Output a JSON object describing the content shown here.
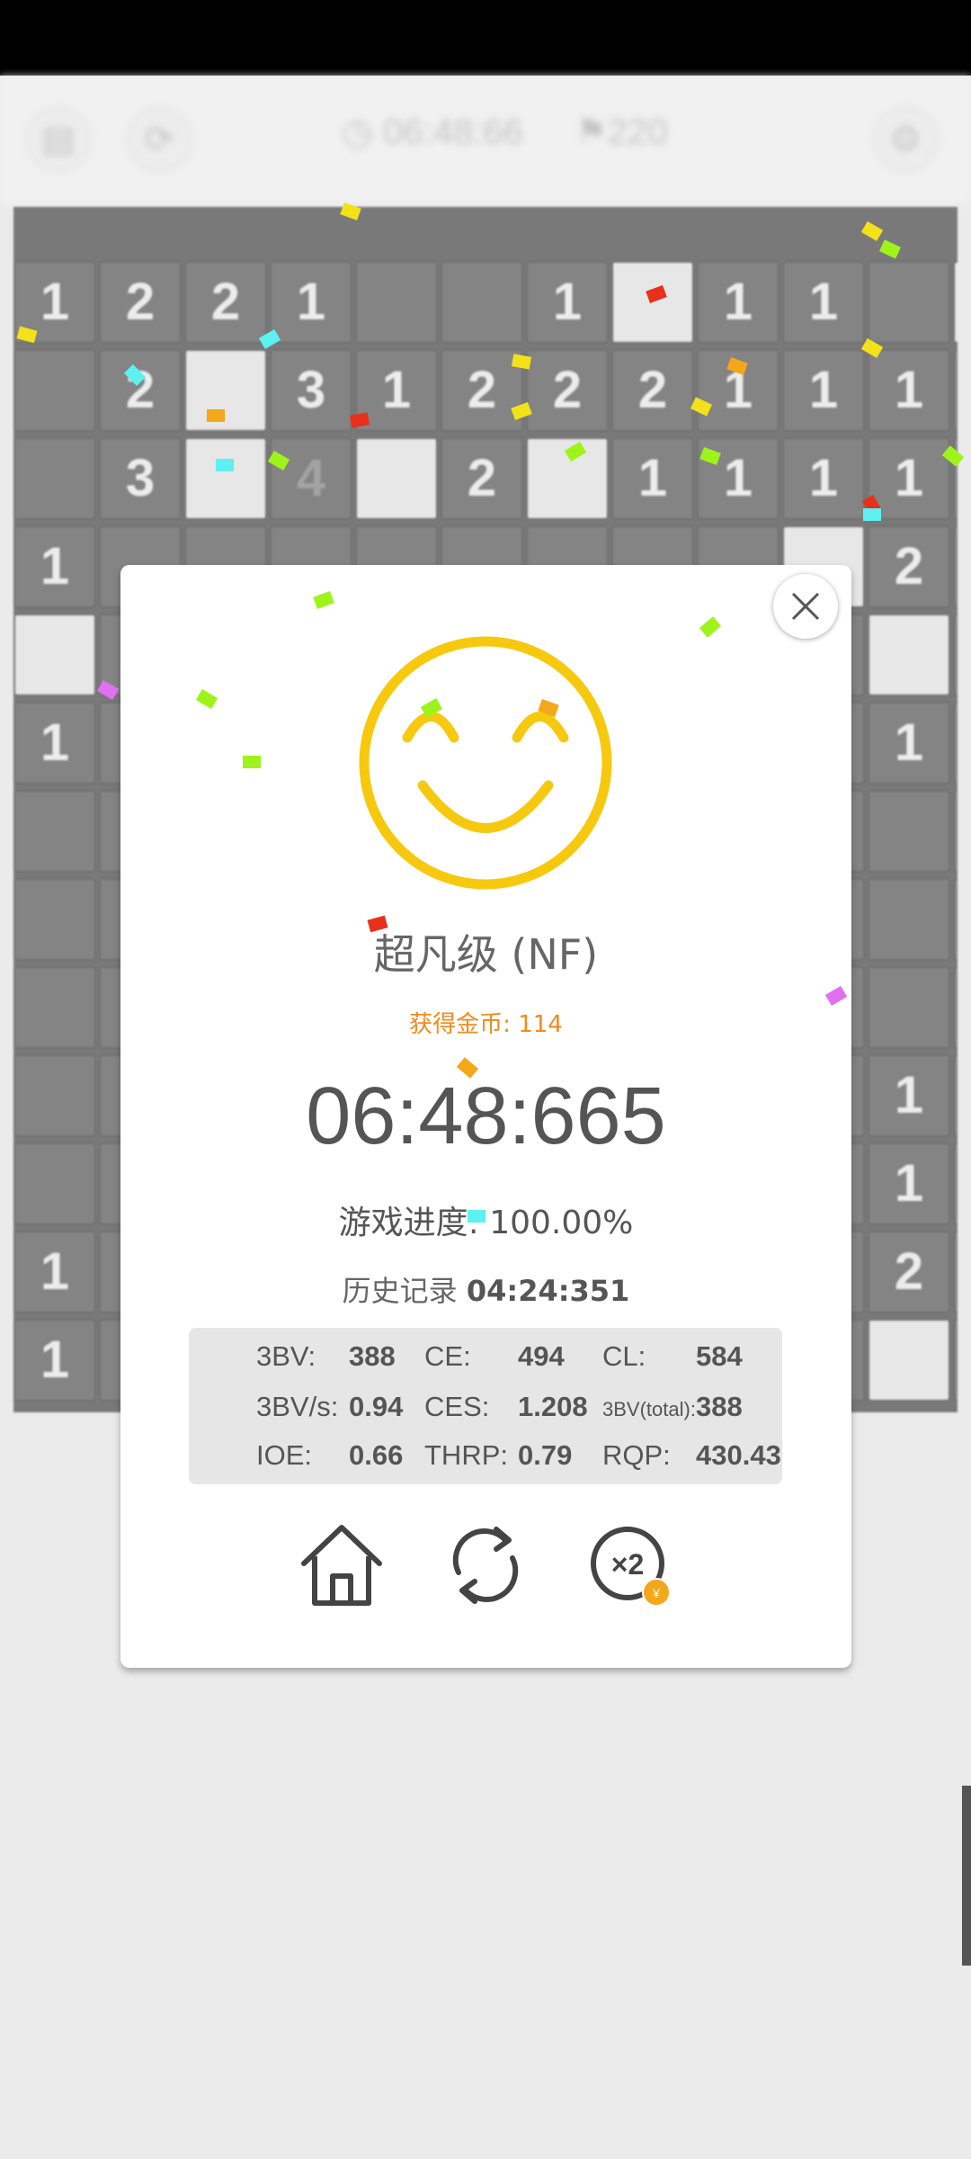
{
  "topbar": {
    "timer": "06:48:66",
    "flags": "220"
  },
  "board_rows": [
    [
      "1",
      "2",
      "2",
      "1",
      "",
      "",
      "1",
      "",
      "1",
      "1",
      "",
      ""
    ],
    [
      "",
      "2",
      "",
      "3",
      "1",
      "2",
      "2",
      "2",
      "1",
      "1",
      "1",
      ""
    ],
    [
      "",
      "3",
      "",
      "4",
      "",
      "2",
      "",
      "1",
      "1",
      "1",
      "1",
      ""
    ],
    [
      "1",
      "",
      "",
      "",
      "",
      "",
      "",
      "",
      "",
      "",
      "2",
      ""
    ],
    [
      "",
      "",
      "",
      "",
      "",
      "",
      "",
      "",
      "",
      "",
      "",
      ""
    ],
    [
      "1",
      "",
      "",
      "",
      "",
      "",
      "",
      "",
      "",
      "",
      "1",
      ""
    ],
    [
      "",
      "",
      "",
      "",
      "",
      "",
      "",
      "",
      "",
      "",
      "",
      ""
    ],
    [
      "",
      "",
      "",
      "",
      "",
      "",
      "",
      "",
      "",
      "",
      "",
      ""
    ],
    [
      "",
      "",
      "",
      "",
      "",
      "",
      "",
      "",
      "",
      "",
      "",
      ""
    ],
    [
      "",
      "",
      "",
      "",
      "",
      "",
      "",
      "",
      "",
      "",
      "1",
      ""
    ],
    [
      "",
      "",
      "",
      "",
      "",
      "",
      "",
      "",
      "",
      "",
      "1",
      ""
    ],
    [
      "1",
      "",
      "",
      "",
      "",
      "",
      "",
      "",
      "",
      "",
      "2",
      ""
    ],
    [
      "1",
      "",
      "",
      "",
      "",
      "",
      "",
      "",
      "",
      "",
      "",
      ""
    ]
  ],
  "result": {
    "rank": "超凡级 (NF)",
    "coins": "获得金币: 114",
    "time": "06:48:665",
    "progress": "游戏进度:  100.00%",
    "record_label": "历史记录 ",
    "record_value": "04:24:351"
  },
  "stats": {
    "bv_label": "3BV:",
    "bv": "388",
    "ce_label": "CE:",
    "ce": "494",
    "cl_label": "CL:",
    "cl": "584",
    "bvs_label": "3BV/s:",
    "bvs": "0.94",
    "ces_label": "CES:",
    "ces": "1.208",
    "bvt_label": "3BV(total):",
    "bvt": "388",
    "ioe_label": "IOE:",
    "ioe": "0.66",
    "thrp_label": "THRP:",
    "thrp": "0.79",
    "rqp_label": "RQP:",
    "rqp": "430.43"
  },
  "icons": {
    "home": "home-icon",
    "restart": "refresh-icon",
    "double": "x2-coin-icon",
    "close": "close-icon"
  },
  "colors": {
    "smiley": "#f6c90e",
    "coins": "#f18a1a",
    "coin_badge": "#f3a71a"
  }
}
